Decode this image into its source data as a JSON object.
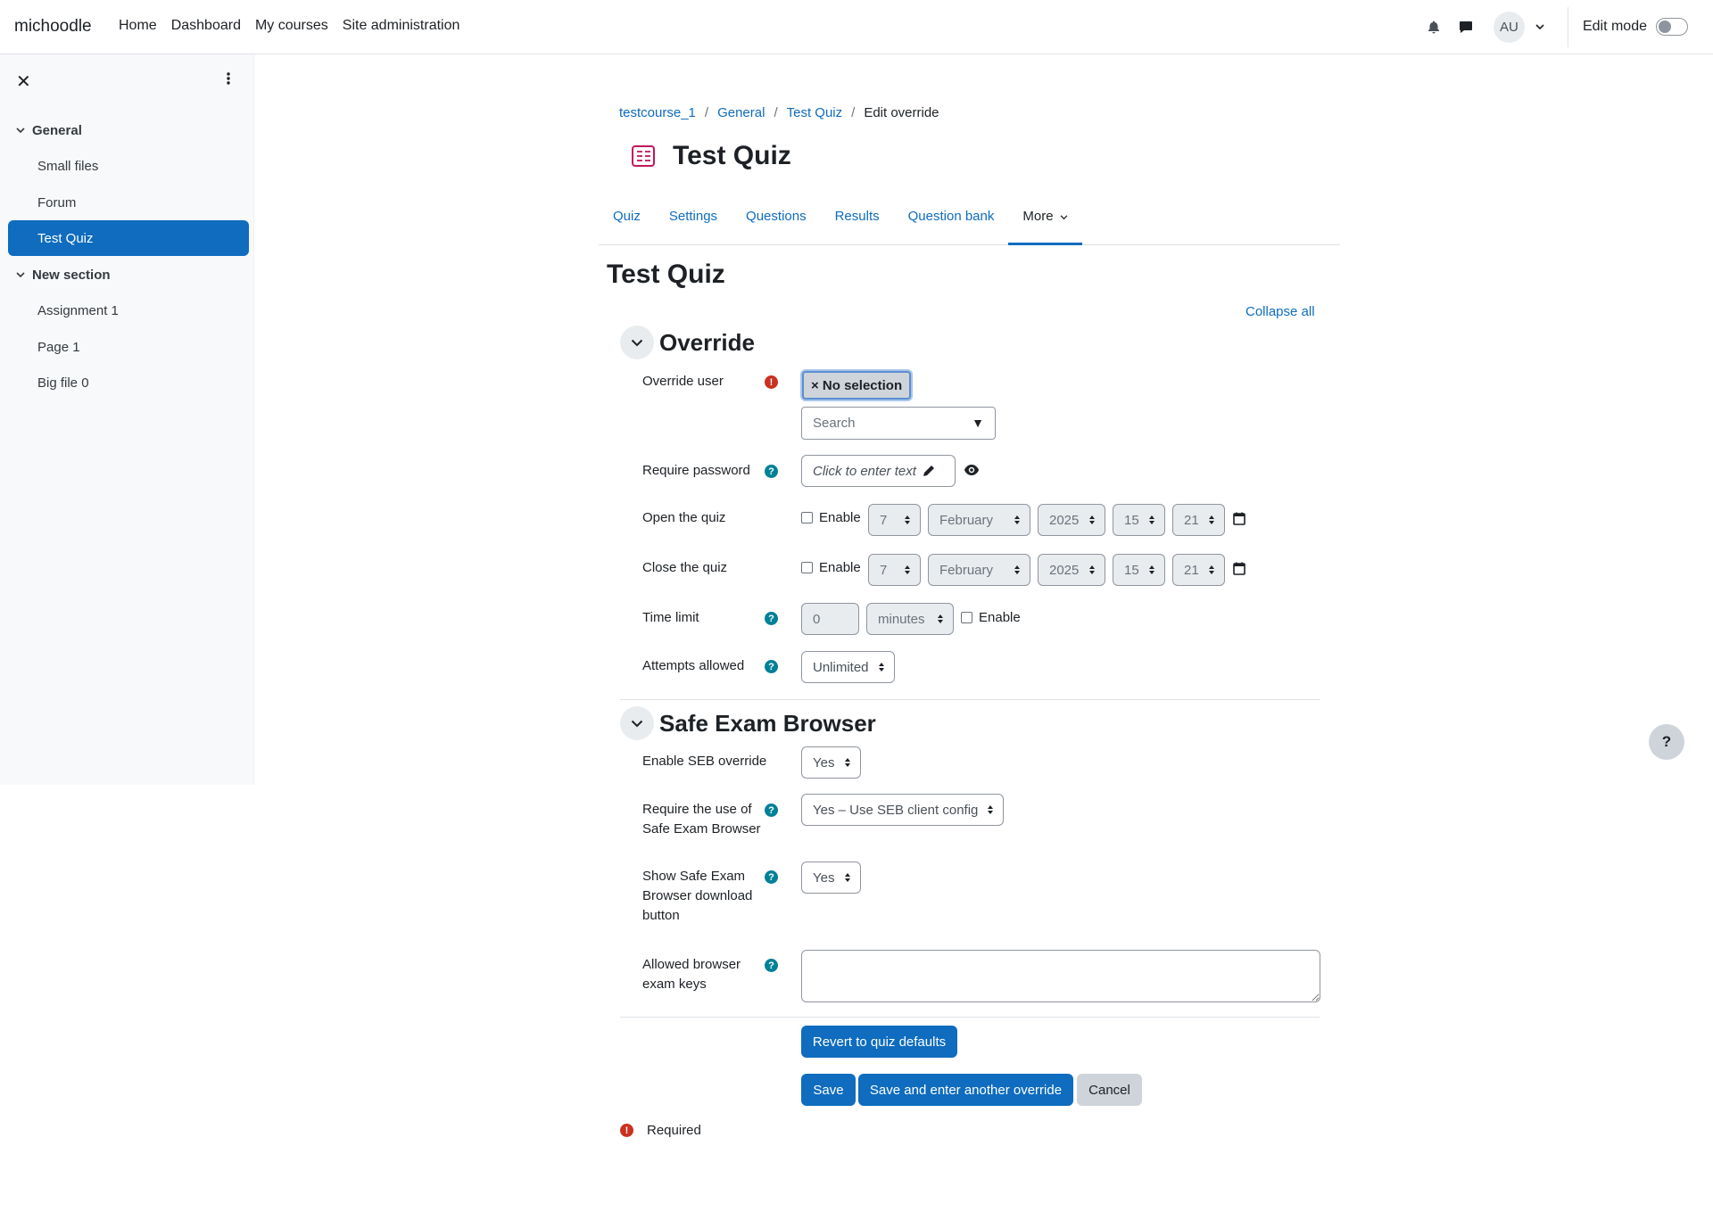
{
  "navbar": {
    "brand": "michoodle",
    "links": [
      "Home",
      "Dashboard",
      "My courses",
      "Site administration"
    ],
    "avatar_initials": "AU",
    "edit_mode_label": "Edit mode"
  },
  "drawer": {
    "sections": [
      {
        "title": "General",
        "items": [
          "Small files",
          "Forum",
          "Test Quiz"
        ]
      },
      {
        "title": "New section",
        "items": [
          "Assignment 1",
          "Page 1",
          "Big file 0"
        ]
      }
    ],
    "active_item": "Test Quiz"
  },
  "breadcrumb": [
    "testcourse_1",
    "General",
    "Test Quiz",
    "Edit override"
  ],
  "page": {
    "title": "Test Quiz",
    "heading": "Test Quiz",
    "collapse_all": "Collapse all"
  },
  "tabs": [
    "Quiz",
    "Settings",
    "Questions",
    "Results",
    "Question bank",
    "More"
  ],
  "override_section": {
    "title": "Override",
    "override_user_label": "Override user",
    "no_selection": "× No selection",
    "search_placeholder": "Search",
    "require_password_label": "Require password",
    "password_placeholder": "Click to enter text",
    "open_quiz_label": "Open the quiz",
    "close_quiz_label": "Close the quiz",
    "enable_label": "Enable",
    "open_date": {
      "day": "7",
      "month": "February",
      "year": "2025",
      "hour": "15",
      "minute": "21"
    },
    "close_date": {
      "day": "7",
      "month": "February",
      "year": "2025",
      "hour": "15",
      "minute": "21"
    },
    "time_limit_label": "Time limit",
    "time_limit_value": "0",
    "time_limit_unit": "minutes",
    "attempts_label": "Attempts allowed",
    "attempts_value": "Unlimited"
  },
  "seb_section": {
    "title": "Safe Exam Browser",
    "enable_override_label": "Enable SEB override",
    "enable_override_value": "Yes",
    "require_use_label_1": "Require the use of",
    "require_use_label_2": "Safe Exam Browser",
    "require_use_value": "Yes – Use SEB client config",
    "show_download_label_1": "Show Safe Exam",
    "show_download_label_2": "Browser download",
    "show_download_label_3": "button",
    "show_download_value": "Yes",
    "allowed_keys_label_1": "Allowed browser",
    "allowed_keys_label_2": "exam keys"
  },
  "buttons": {
    "revert": "Revert to quiz defaults",
    "save": "Save",
    "save_another": "Save and enter another override",
    "cancel": "Cancel"
  },
  "required_note": "Required",
  "help_float": "?",
  "colors": {
    "primary": "#0f6cbf",
    "required": "#ca3120",
    "help": "#008196",
    "quiz_icon": "#c2185b"
  }
}
